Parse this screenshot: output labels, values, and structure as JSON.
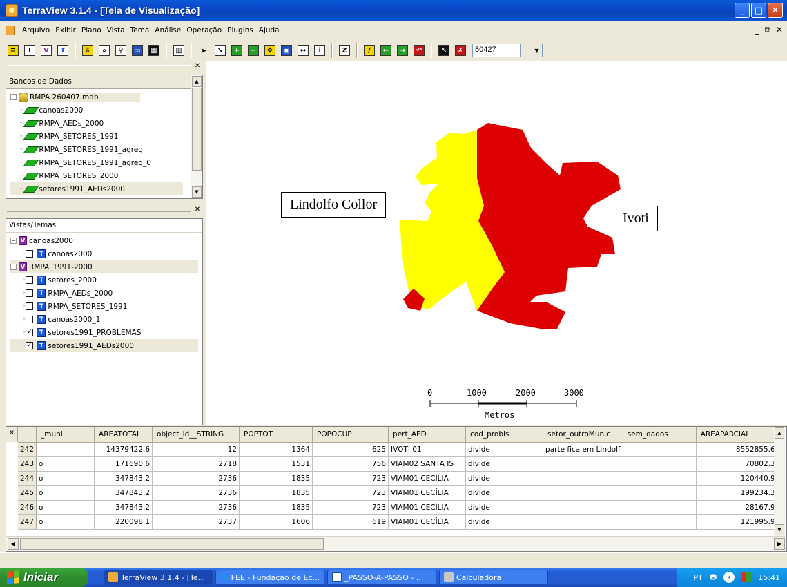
{
  "window": {
    "title": "TerraView 3.1.4 - [Tela de Visualização]"
  },
  "menu": [
    "Arquivo",
    "Exibir",
    "Plano",
    "Vista",
    "Tema",
    "Análise",
    "Operação",
    "Plugins",
    "Ajuda"
  ],
  "toolbar": {
    "scale_value": "50427"
  },
  "databases_panel": {
    "header": "Bancos de Dados",
    "database": "RMPA 260407.mdb",
    "layers": [
      "canoas2000",
      "RMPA_AEDs_2000",
      "RMPA_SETORES_1991",
      "RMPA_SETORES_1991_agreg",
      "RMPA_SETORES_1991_agreg_0",
      "RMPA_SETORES_2000",
      "setores1991_AEDs2000"
    ]
  },
  "views_panel": {
    "header": "Vistas/Temas",
    "views": [
      {
        "name": "canoas2000",
        "themes": [
          {
            "name": "canoas2000",
            "checked": false
          }
        ]
      },
      {
        "name": "RMPA_1991-2000",
        "themes": [
          {
            "name": "setores_2000",
            "checked": false
          },
          {
            "name": "RMPA_AEDs_2000",
            "checked": false
          },
          {
            "name": "RMPA_SETORES_1991",
            "checked": false
          },
          {
            "name": "canoas2000_1",
            "checked": false
          },
          {
            "name": "setores1991_PROBLEMAS",
            "checked": true
          },
          {
            "name": "setores1991_AEDs2000",
            "checked": true
          }
        ]
      }
    ]
  },
  "map": {
    "labels": {
      "left": "Lindolfo Collor",
      "right": "Ivoti"
    },
    "colors": {
      "left_region": "#ffff00",
      "right_region": "#dd0000"
    },
    "scalebar": {
      "ticks": [
        "0",
        "1000",
        "2000",
        "3000"
      ],
      "unit": "Metros"
    }
  },
  "table": {
    "columns": [
      "_muni",
      "AREATOTAL",
      "object_id__STRING",
      "POPTOT",
      "POPOCUP",
      "pert_AED",
      "cod_probls",
      "setor_outroMunic",
      "sem_dados",
      "AREAPARCIAL"
    ],
    "rows": [
      {
        "id": "242",
        "cells": [
          "",
          "14379422.6",
          "12",
          "1364",
          "625",
          "IVOTI 01",
          "divide",
          "parte fica em Lindolf",
          "",
          "8552855.6"
        ]
      },
      {
        "id": "243",
        "cells": [
          "o",
          "171690.6",
          "2718",
          "1531",
          "756",
          "VIAM02  SANTA IS",
          "divide",
          "",
          "",
          "70802.3"
        ]
      },
      {
        "id": "244",
        "cells": [
          "o",
          "347843.2",
          "2736",
          "1835",
          "723",
          "VIAM01  CECÍLIA",
          "divide",
          "",
          "",
          "120440.9"
        ]
      },
      {
        "id": "245",
        "cells": [
          "o",
          "347843.2",
          "2736",
          "1835",
          "723",
          "VIAM01  CECÍLIA",
          "divide",
          "",
          "",
          "199234.3"
        ]
      },
      {
        "id": "246",
        "cells": [
          "o",
          "347843.2",
          "2736",
          "1835",
          "723",
          "VIAM01  CECÍLIA",
          "divide",
          "",
          "",
          "28167.9"
        ]
      },
      {
        "id": "247",
        "cells": [
          "o",
          "220098.1",
          "2737",
          "1606",
          "619",
          "VIAM01  CECÍLIA",
          "divide",
          "",
          "",
          "121995.9"
        ]
      }
    ]
  },
  "taskbar": {
    "start": "Iniciar",
    "tasks": [
      "TerraView 3.1.4 - [Te...",
      "FEE - Fundação de Ec...",
      "_PASSO-A-PASSO - ...",
      "Calculadora"
    ],
    "lang": "PT",
    "clock": "15:41"
  }
}
